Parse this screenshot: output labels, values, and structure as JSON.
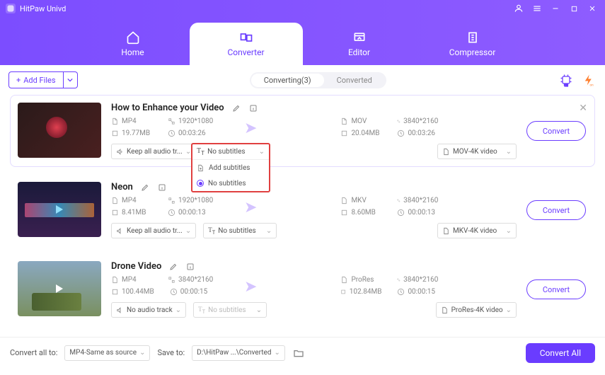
{
  "app": {
    "title": "HitPaw Univd"
  },
  "nav": {
    "home": "Home",
    "converter": "Converter",
    "editor": "Editor",
    "compressor": "Compressor"
  },
  "toolbar": {
    "add_files": "Add Files"
  },
  "subtabs": {
    "converting": "Converting(3)",
    "converted": "Converted"
  },
  "videos": [
    {
      "title": "How to Enhance your Video",
      "src": {
        "fmt": "MP4",
        "res": "1920*1080",
        "size": "19.77MB",
        "dur": "00:03:26"
      },
      "dst": {
        "fmt": "MOV",
        "res": "3840*2160",
        "size": "20.04MB",
        "dur": "00:03:26"
      },
      "audio": "Keep all audio tr...",
      "sub": "No subtitles",
      "preset": "MOV-4K video"
    },
    {
      "title": "Neon",
      "src": {
        "fmt": "MP4",
        "res": "1920*1080",
        "size": "8.41MB",
        "dur": "00:00:13"
      },
      "dst": {
        "fmt": "MKV",
        "res": "3840*2160",
        "size": "8.60MB",
        "dur": "00:00:13"
      },
      "audio": "Keep all audio tr...",
      "sub": "No subtitles",
      "preset": "MKV-4K video"
    },
    {
      "title": "Drone Video",
      "src": {
        "fmt": "MP4",
        "res": "3840*2160",
        "size": "100.44MB",
        "dur": "00:00:15"
      },
      "dst": {
        "fmt": "ProRes",
        "res": "3840*2160",
        "size": "102.84MB",
        "dur": "00:00:15"
      },
      "audio": "No audio track",
      "sub": "No subtitles",
      "preset": "ProRes-4K video"
    }
  ],
  "sub_menu": {
    "head": "No subtitles",
    "add": "Add subtitles",
    "none": "No subtitles"
  },
  "labels": {
    "convert": "Convert"
  },
  "footer": {
    "convert_all_to": "Convert all to:",
    "format": "MP4-Same as source",
    "save_to": "Save to:",
    "path": "D:\\HitPaw ...\\Converted",
    "convert_all": "Convert All"
  }
}
